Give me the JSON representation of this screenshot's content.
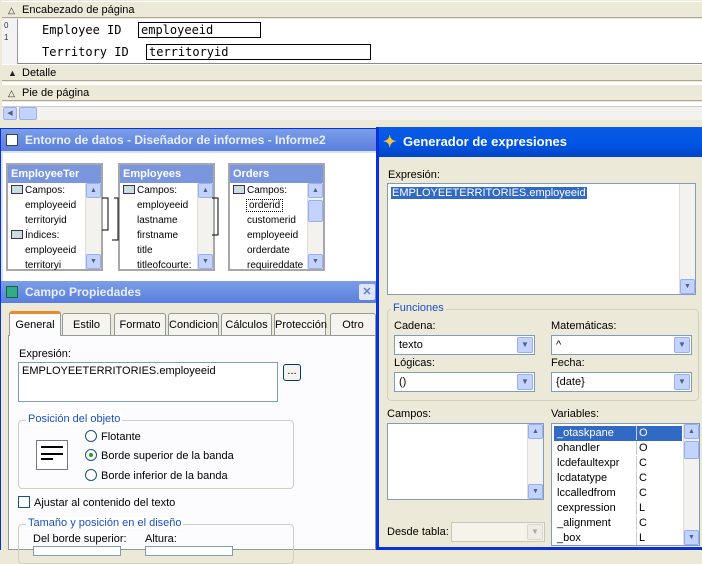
{
  "report": {
    "header_band": "Encabezado de página",
    "detail_band": "Detalle",
    "footer_band": "Pie de página",
    "ruler_marks": [
      "0",
      "1"
    ],
    "fields": [
      {
        "label": "Employee ID",
        "value": "employeeid"
      },
      {
        "label": "Territory ID",
        "value": "territoryid"
      }
    ]
  },
  "dataenv": {
    "title": "Entorno de datos - Diseñador de informes - Informe2",
    "tables": [
      {
        "name": "EmployeeTer",
        "rows": [
          {
            "text": "Campos:",
            "group": true
          },
          {
            "text": "employeeid"
          },
          {
            "text": "territoryid"
          },
          {
            "text": "Índices:",
            "group": true
          },
          {
            "text": "employeeid"
          },
          {
            "text": "territoryi"
          }
        ]
      },
      {
        "name": "Employees",
        "rows": [
          {
            "text": "Campos:",
            "group": true
          },
          {
            "text": "employeeid"
          },
          {
            "text": "lastname"
          },
          {
            "text": "firstname"
          },
          {
            "text": "title"
          },
          {
            "text": "titleofcourte:"
          }
        ]
      },
      {
        "name": "Orders",
        "rows": [
          {
            "text": "Campos:",
            "group": true
          },
          {
            "text": "orderid",
            "selected": true
          },
          {
            "text": "customerid"
          },
          {
            "text": "employeeid"
          },
          {
            "text": "orderdate"
          },
          {
            "text": "requireddate"
          }
        ]
      }
    ]
  },
  "props": {
    "title": "Campo Propiedades",
    "tabs": [
      "General",
      "Estilo",
      "Formato",
      "Condicion",
      "Cálculos",
      "Protección",
      "Otro"
    ],
    "expression_label": "Expresión:",
    "expression_value": "EMPLOYEETERRITORIES.employeeid",
    "ellipsis": "...",
    "position_group": "Posición del objeto",
    "radio_options": [
      {
        "label": "Flotante",
        "checked": false
      },
      {
        "label": "Borde superior de la banda",
        "checked": true
      },
      {
        "label": "Borde inferior de la banda",
        "checked": false
      }
    ],
    "fit_checkbox": "Ajustar al contenido del texto",
    "size_group": "Tamaño y posición en el diseño",
    "from_top_label": "Del borde superior:",
    "height_label": "Altura:"
  },
  "expr": {
    "title": "Generador de expresiones",
    "expression_label": "Expresión:",
    "expression_value": "EMPLOYEETERRITORIES.employeeid",
    "functions_group": "Funciones",
    "string_label": "Cadena:",
    "string_value": "texto",
    "math_label": "Matemáticas:",
    "math_value": "^",
    "logic_label": "Lógicas:",
    "logic_value": "()",
    "date_label": "Fecha:",
    "date_value": "{date}",
    "fields_label": "Campos:",
    "variables_label": "Variables:",
    "from_table_label": "Desde tabla:",
    "variables": [
      {
        "name": "_otaskpane",
        "type": "O",
        "selected": true
      },
      {
        "name": "ohandler",
        "type": "O"
      },
      {
        "name": "lcdefaultexpr",
        "type": "C"
      },
      {
        "name": "lcdatatype",
        "type": "C"
      },
      {
        "name": "lccalledfrom",
        "type": "C"
      },
      {
        "name": "cexpression",
        "type": "L"
      },
      {
        "name": "_alignment",
        "type": "C"
      },
      {
        "name": "_box",
        "type": "L"
      }
    ]
  },
  "colors": {
    "xp_blue": "#0a246a",
    "title_blue": "#0054e3",
    "selection": "#316ac5"
  }
}
